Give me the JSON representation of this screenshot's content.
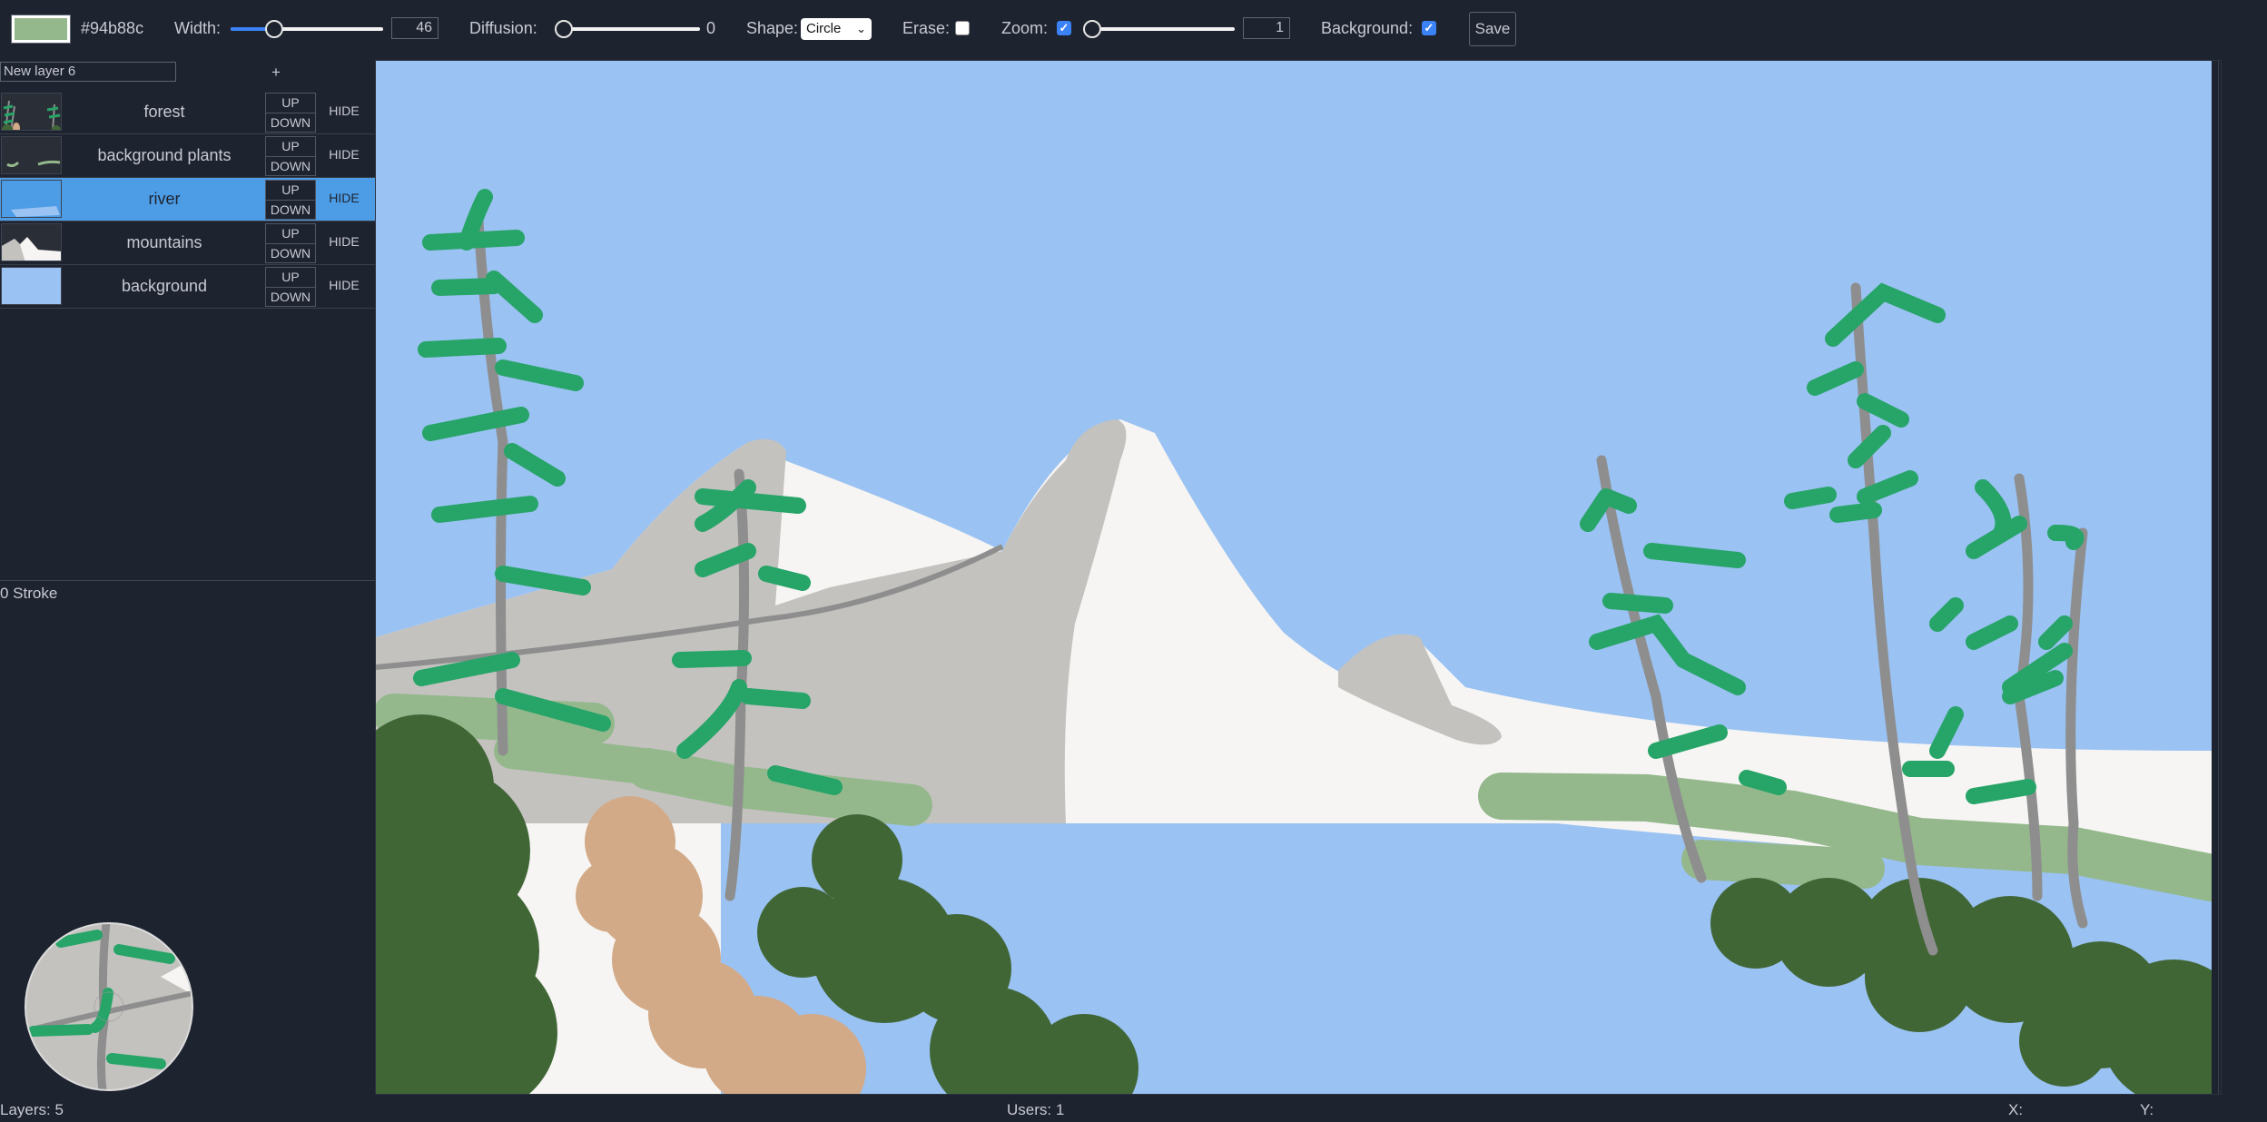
{
  "toolbar": {
    "color_hex": "#94b88c",
    "width_label": "Width:",
    "width_value": "46",
    "width_fraction": 0.26,
    "diffusion_label": "Diffusion:",
    "diffusion_value": "0",
    "diffusion_fraction": 0.0,
    "shape_label": "Shape:",
    "shape_value": "Circle",
    "erase_label": "Erase:",
    "erase_checked": false,
    "zoom_label": "Zoom:",
    "zoom_checked": true,
    "zoom_value": "1",
    "zoom_fraction": 0.0,
    "background_label": "Background:",
    "background_checked": true,
    "save_label": "Save"
  },
  "layers_panel": {
    "new_layer_name": "New layer 6",
    "add_label": "+",
    "up_label": "UP",
    "down_label": "DOWN",
    "hide_label": "HIDE",
    "layers": [
      {
        "name": "forest",
        "selected": false
      },
      {
        "name": "background plants",
        "selected": false
      },
      {
        "name": "river",
        "selected": true
      },
      {
        "name": "mountains",
        "selected": false
      },
      {
        "name": "background",
        "selected": false
      }
    ],
    "stroke_label": "0 Stroke"
  },
  "status": {
    "layers": "Layers: 5",
    "users": "Users: 1",
    "x_label": "X:",
    "y_label": "Y:"
  },
  "colors": {
    "sky": "#9ac2f2",
    "mountain_gray": "#c3c2bf",
    "snow": "#f6f5f3",
    "light_green": "#94b88c",
    "pine_green": "#27a468",
    "dark_green": "#416636",
    "path_tan": "#d2aa88",
    "trunk_gray": "#8e8e8e",
    "panel_bg": "#1e2330",
    "selected_row": "#4d9de6"
  }
}
